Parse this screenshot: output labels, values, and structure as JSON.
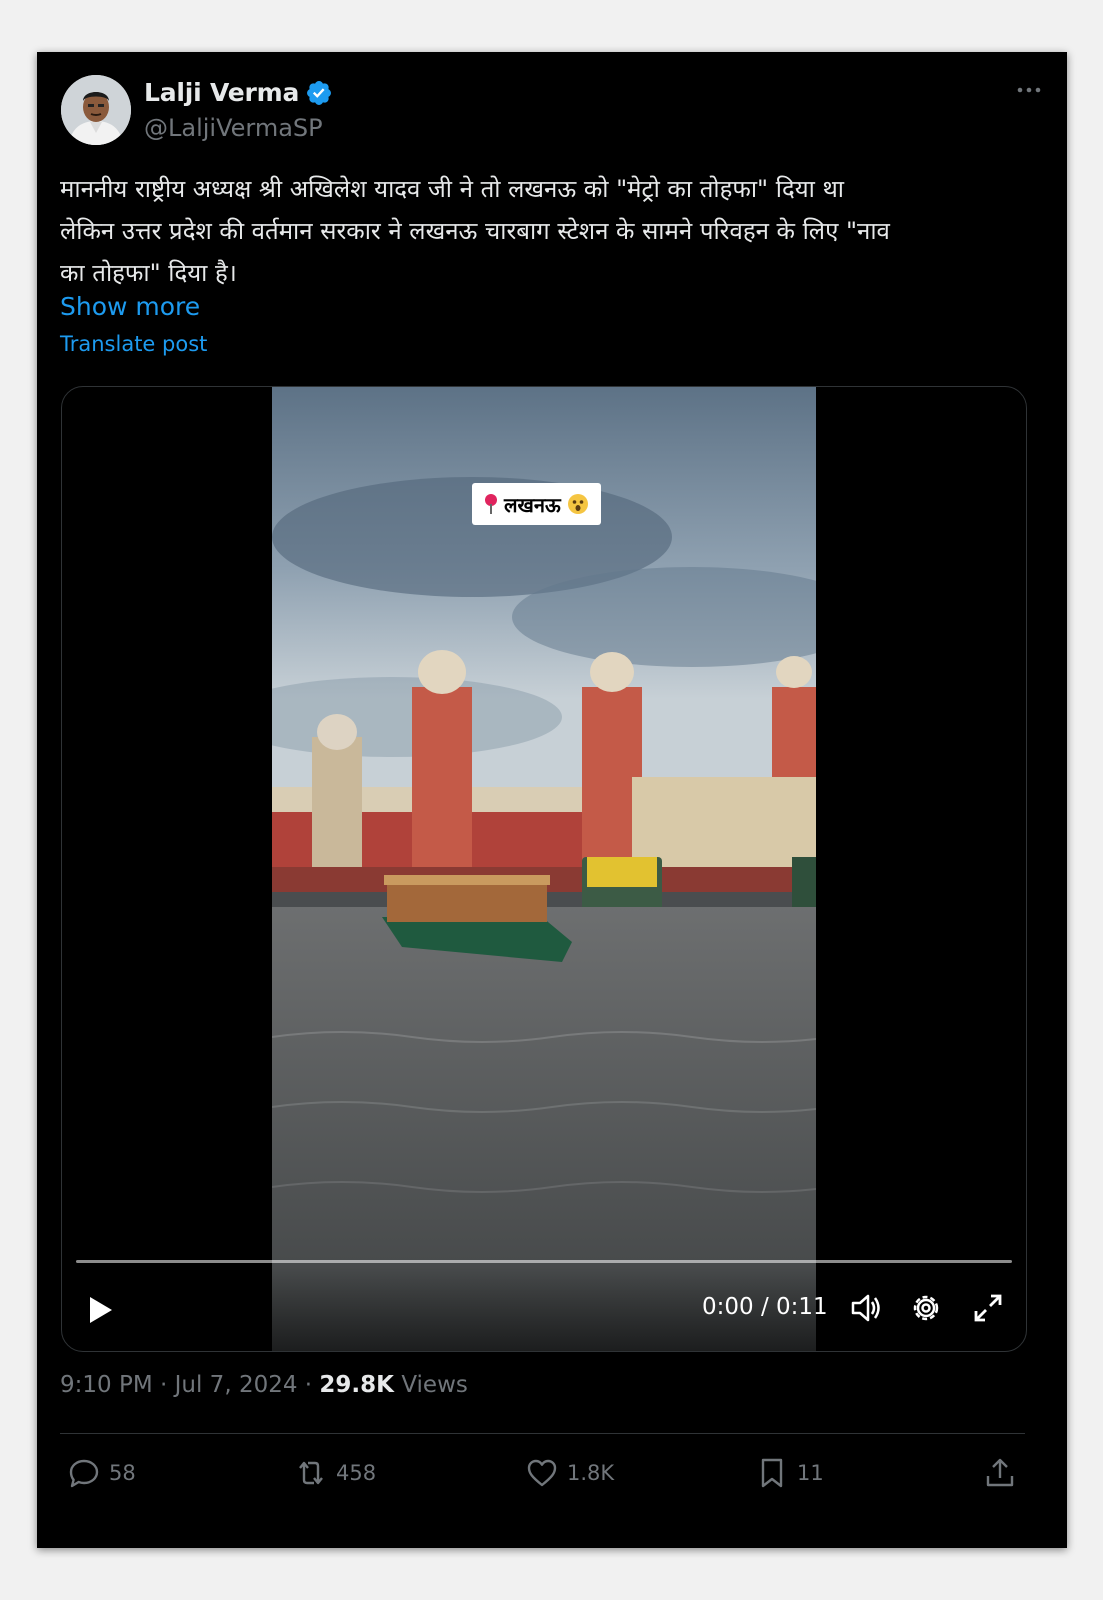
{
  "author": {
    "name": "Lalji Verma",
    "handle": "@LaljiVermaSP"
  },
  "tweet": {
    "text_lines": [
      "माननीय राष्ट्रीय अध्यक्ष श्री अखिलेश यादव जी ने तो लखनऊ को \"मेट्रो का तोहफा\" दिया था",
      "लेकिन उत्तर प्रदेश की वर्तमान सरकार ने लखनऊ चारबाग स्टेशन के सामने परिवहन के लिए \"नाव",
      "का तोहफा\" दिया है।"
    ],
    "show_more": "Show more",
    "translate": "Translate post"
  },
  "video": {
    "overlay_label": "लखनऊ",
    "time": "0:00 / 0:11",
    "progress": 0
  },
  "meta": {
    "time": "9:10 PM",
    "date": "Jul 7, 2024",
    "views_count": "29.8K",
    "views_label": "Views"
  },
  "actions": {
    "replies": "58",
    "reposts": "458",
    "likes": "1.8K",
    "bookmarks": "11"
  },
  "colors": {
    "accent": "#1d9bf0",
    "background": "#000000",
    "muted": "#71767b"
  }
}
